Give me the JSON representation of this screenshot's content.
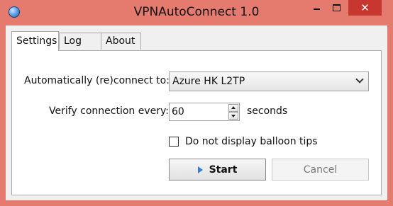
{
  "window": {
    "title": "VPNAutoConnect 1.0",
    "close_glyph": "✕"
  },
  "tabs": [
    {
      "label": "Settings",
      "selected": true
    },
    {
      "label": "Log",
      "selected": false
    },
    {
      "label": "About",
      "selected": false
    }
  ],
  "settings": {
    "connect_label": "Automatically (re)connect to:",
    "connect_value": "Azure HK L2TP",
    "verify_label": "Verify connection every:",
    "verify_value": "60",
    "verify_unit": "seconds",
    "balloon_label": "Do not display balloon tips",
    "balloon_checked": false,
    "start_label": "Start",
    "cancel_label": "Cancel",
    "cancel_enabled": false
  },
  "colors": {
    "titlebar": "#e57a6f",
    "close_button": "#c7372f",
    "start_icon": "#3b7bd8"
  },
  "icons": {
    "app": "globe-icon",
    "start": "play-icon"
  }
}
